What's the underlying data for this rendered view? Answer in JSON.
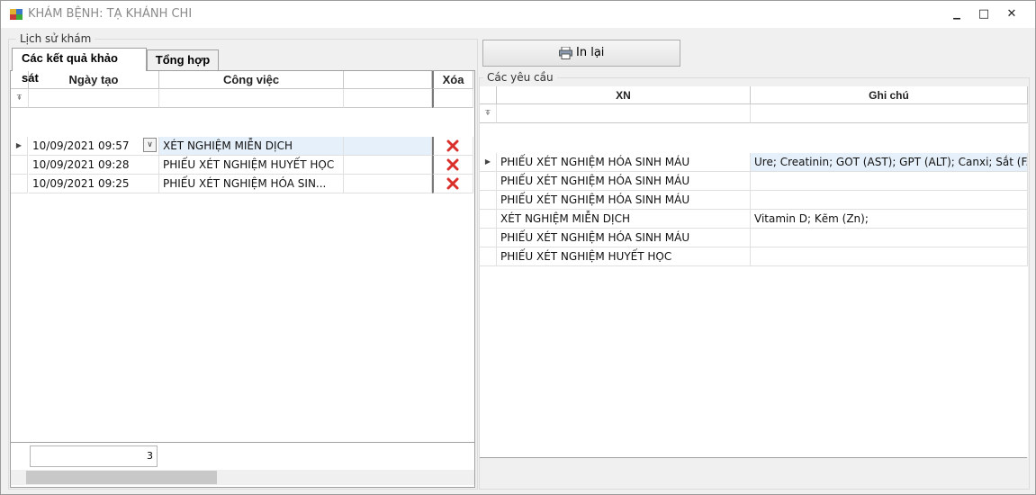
{
  "window": {
    "title": "KHÁM BỆNH: TẠ KHÁNH CHI",
    "minimize_glyph": "▁",
    "maximize_glyph": "□",
    "close_glyph": "✕"
  },
  "history_group": {
    "legend": "Lịch sử khám",
    "tabs": [
      {
        "label": "Các kết quả khảo sát",
        "active": true
      },
      {
        "label": "Tổng hợp",
        "active": false
      }
    ],
    "grid": {
      "columns": [
        "Ngày tạo",
        "Công việc",
        "",
        "Xóa"
      ],
      "rows": [
        {
          "date": "10/09/2021 09:57",
          "task": "XÉT NGHIỆM MIỄN DỊCH",
          "selected": true
        },
        {
          "date": "10/09/2021 09:28",
          "task": "PHIẾU XÉT NGHIỆM HUYẾT HỌC",
          "selected": false
        },
        {
          "date": "10/09/2021 09:25",
          "task": "PHIẾU XÉT NGHIỆM HÓA SIN...",
          "selected": false
        }
      ],
      "delete_icon": "red-x-icon"
    },
    "count": "3"
  },
  "requests_group": {
    "reprint_label": "In lại",
    "legend": "Các yêu cầu",
    "grid": {
      "columns": [
        "XN",
        "Ghi chú"
      ],
      "rows": [
        {
          "xn": "PHIẾU XÉT NGHIỆM HÓA SINH MÁU",
          "note": "Ure; Creatinin; GOT (AST); GPT (ALT); Canxi; Sắt (F...",
          "selected": true
        },
        {
          "xn": "PHIẾU XÉT NGHIỆM HÓA SINH MÁU",
          "note": ""
        },
        {
          "xn": "PHIẾU XÉT NGHIỆM HÓA SINH MÁU",
          "note": ""
        },
        {
          "xn": "XÉT NGHIỆM MIỄN DỊCH",
          "note": "Vitamin D; Kẽm (Zn);"
        },
        {
          "xn": "PHIẾU XÉT NGHIỆM HÓA SINH MÁU",
          "note": ""
        },
        {
          "xn": "PHIẾU XÉT NGHIỆM HUYẾT HỌC",
          "note": ""
        }
      ]
    }
  },
  "colors": {
    "selected_row": "#e6f0fa",
    "delete_red": "#d9302c"
  }
}
